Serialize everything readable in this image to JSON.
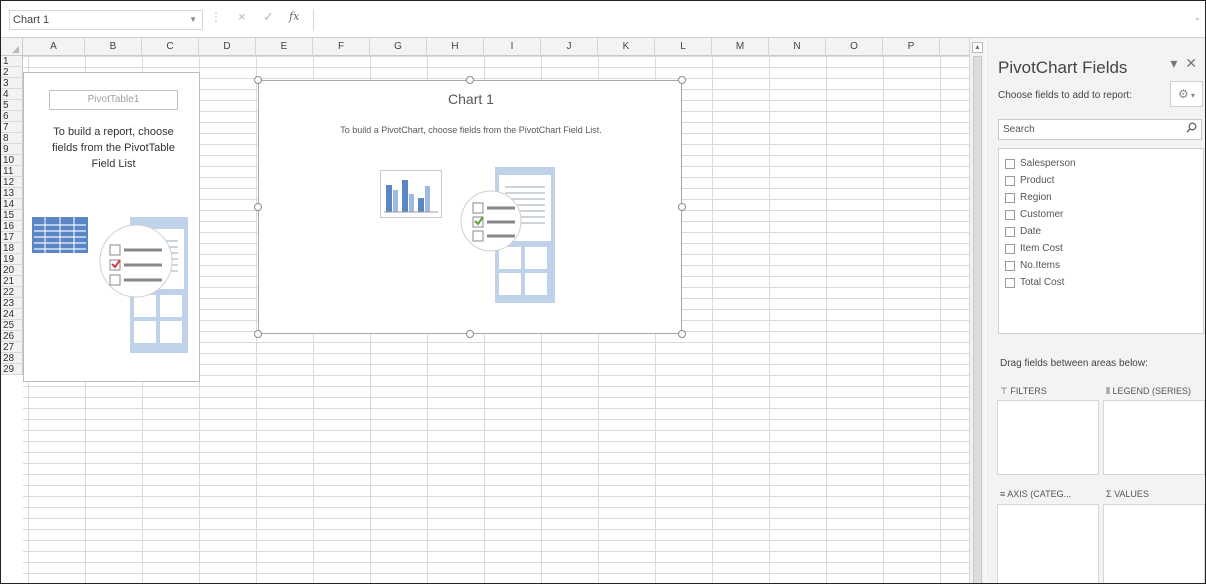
{
  "formula_bar": {
    "name_box": "Chart 1",
    "cancel_glyph": "×",
    "enter_glyph": "✓",
    "fx_label": "fx",
    "formula": ""
  },
  "columns": [
    "A",
    "B",
    "C",
    "D",
    "E",
    "F",
    "G",
    "H",
    "I",
    "J",
    "K",
    "L",
    "M",
    "N",
    "O",
    "P"
  ],
  "rows": [
    "1",
    "2",
    "3",
    "4",
    "5",
    "6",
    "7",
    "8",
    "9",
    "10",
    "11",
    "12",
    "13",
    "14",
    "15",
    "16",
    "17",
    "18",
    "19",
    "20",
    "21",
    "22",
    "23",
    "24",
    "25",
    "26",
    "27",
    "28",
    "29"
  ],
  "pivot_placeholder": {
    "name": "PivotTable1",
    "instruction_line1": "To build a report, choose",
    "instruction_line2": "fields from the PivotTable",
    "instruction_line3": "Field List"
  },
  "chart": {
    "title": "Chart 1",
    "instruction": "To build a PivotChart, choose fields from the PivotChart Field List."
  },
  "pane": {
    "title": "PivotChart Fields",
    "subtitle": "Choose fields to add to report:",
    "search_placeholder": "Search",
    "fields": [
      "Salesperson",
      "Product",
      "Region",
      "Customer",
      "Date",
      "Item Cost",
      "No.Items",
      "Total Cost"
    ],
    "drag_hint": "Drag fields between areas below:",
    "areas": {
      "filters": "FILTERS",
      "legend": "LEGEND (SERIES)",
      "axis": "AXIS (CATEG...",
      "values": "VALUES"
    }
  },
  "colors": {
    "accent_blue": "#4472c4",
    "pane_bg": "#f3f3f3",
    "check_green": "#5b9c3a",
    "check_red": "#d23c3c"
  }
}
